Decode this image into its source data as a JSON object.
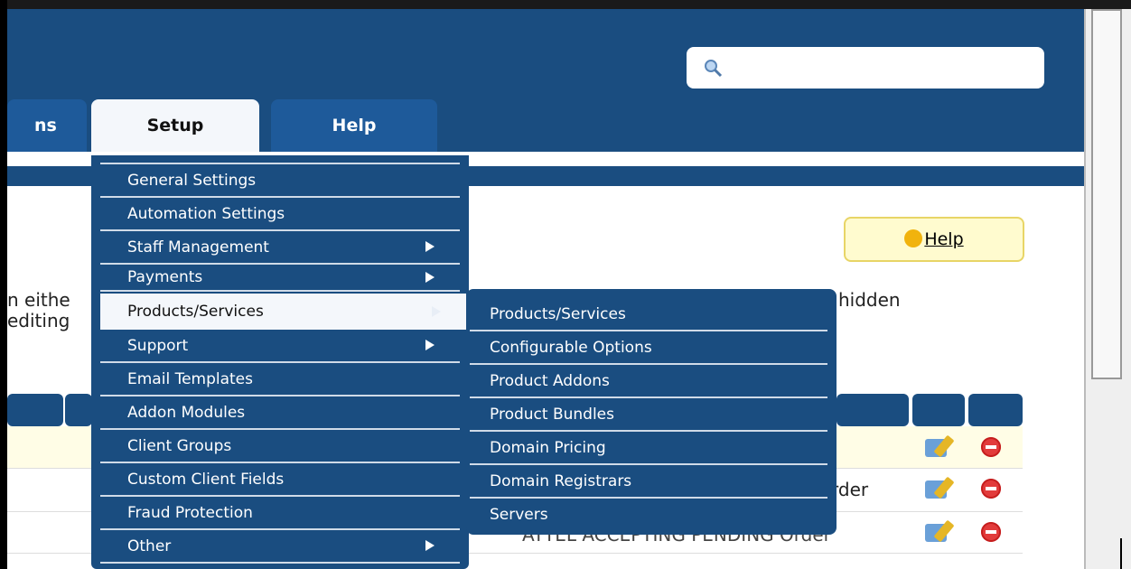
{
  "tabs": {
    "prev_partial": "ns",
    "setup": "Setup",
    "help": "Help"
  },
  "search": {
    "placeholder": "",
    "icon": "search-icon"
  },
  "help_box": {
    "label": "Help",
    "icon": "lightbulb-icon"
  },
  "page_text": {
    "frag_left_1": "n eithe",
    "frag_left_2": "editing",
    "frag_right": "hidden",
    "row2_partial": "rder",
    "row3_partial": "ATTEL ACCEPTING PENDING Order"
  },
  "setup_menu": {
    "items": [
      {
        "label": "General Settings",
        "has_submenu": false
      },
      {
        "label": "Automation Settings",
        "has_submenu": false
      },
      {
        "label": "Staff Management",
        "has_submenu": true
      },
      {
        "label": "Payments",
        "has_submenu": true
      },
      {
        "label": "Products/Services",
        "has_submenu": true,
        "active": true
      },
      {
        "label": "Support",
        "has_submenu": true
      },
      {
        "label": "Email Templates",
        "has_submenu": false
      },
      {
        "label": "Addon Modules",
        "has_submenu": false
      },
      {
        "label": "Client Groups",
        "has_submenu": false
      },
      {
        "label": "Custom Client Fields",
        "has_submenu": false
      },
      {
        "label": "Fraud Protection",
        "has_submenu": false
      },
      {
        "label": "Other",
        "has_submenu": true
      }
    ]
  },
  "products_submenu": {
    "items": [
      "Products/Services",
      "Configurable Options",
      "Product Addons",
      "Product Bundles",
      "Domain Pricing",
      "Domain Registrars",
      "Servers"
    ]
  },
  "colors": {
    "header": "#1a4d80",
    "tab": "#1e5a9a",
    "active_tab": "#f4f7fb",
    "help_bg": "#fffbcf"
  }
}
